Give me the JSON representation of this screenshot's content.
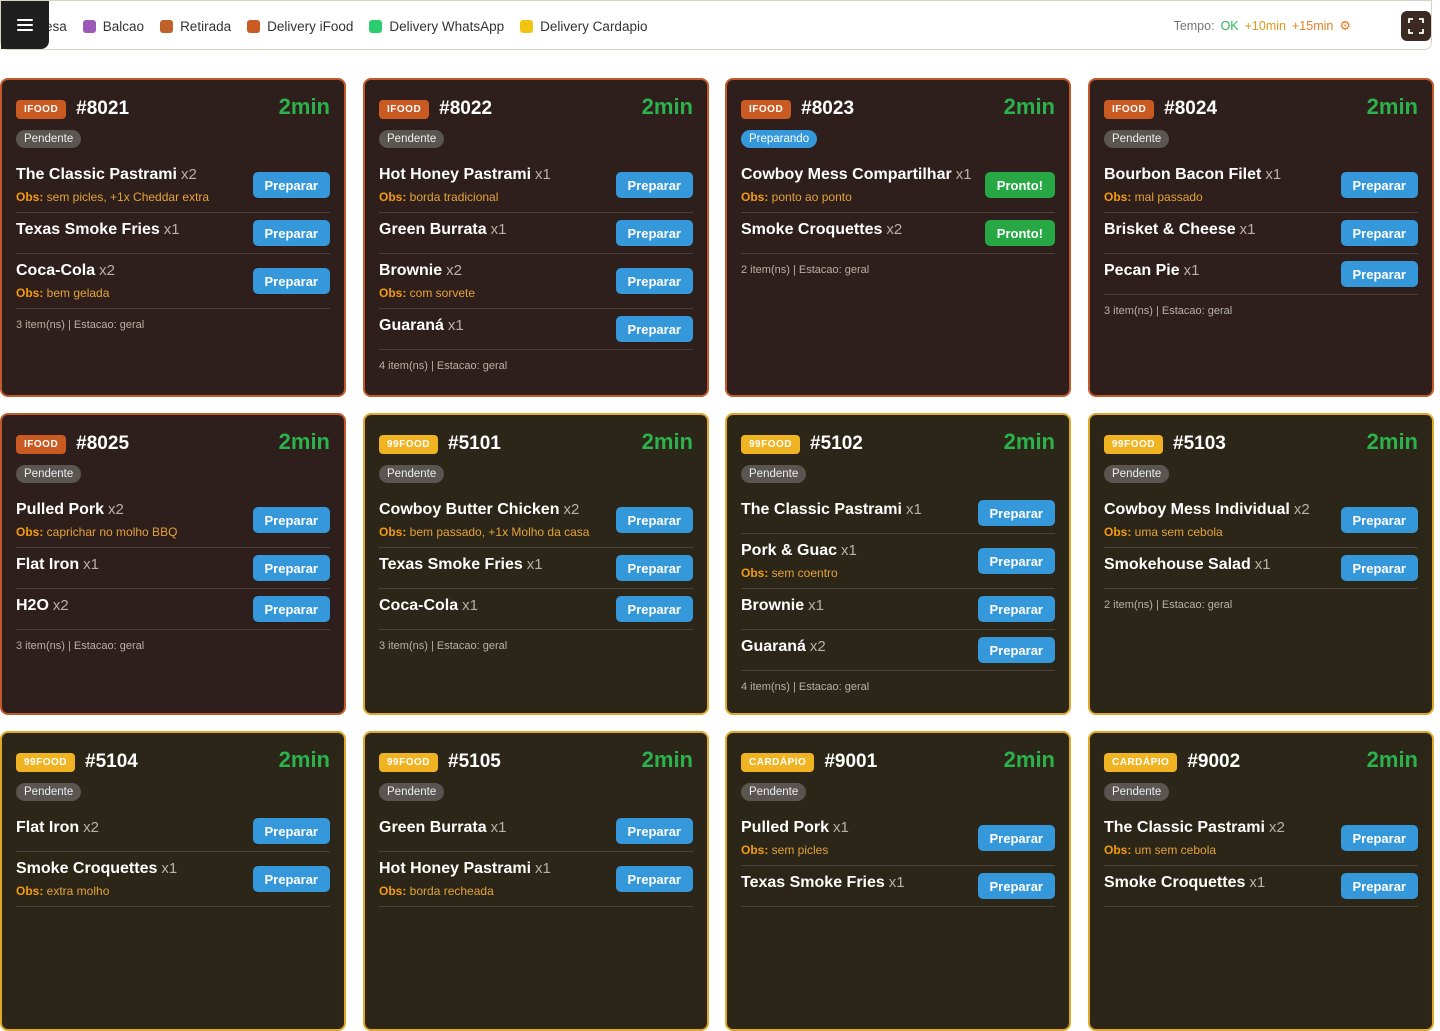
{
  "header": {
    "legend": [
      {
        "label": "esa",
        "color": "#3498db"
      },
      {
        "label": "Balcao",
        "color": "#9b59b6"
      },
      {
        "label": "Retirada",
        "color": "#c0612a"
      },
      {
        "label": "Delivery iFood",
        "color": "#c95a22"
      },
      {
        "label": "Delivery WhatsApp",
        "color": "#2ecc71"
      },
      {
        "label": "Delivery Cardapio",
        "color": "#f1c40f"
      }
    ],
    "tempo_label": "Tempo:",
    "tempo_ok": "OK",
    "tempo_10": "+10min",
    "tempo_15": "+15min",
    "menu_icon": "hamburger-icon",
    "fullscreen_icon": "fullscreen-icon"
  },
  "orders": [
    {
      "kind": "ifood",
      "badge": "IFOOD",
      "number": "#8021",
      "timer": "2min",
      "status": "Pendente",
      "items": [
        {
          "name": "The Classic Pastrami",
          "qty": "x2",
          "obs_label": "Obs:",
          "obs": "sem picles, +1x Cheddar extra",
          "action": "Preparar"
        },
        {
          "name": "Texas Smoke Fries",
          "qty": "x1",
          "action": "Preparar"
        },
        {
          "name": "Coca-Cola",
          "qty": "x2",
          "obs_label": "Obs:",
          "obs": "bem gelada",
          "action": "Preparar"
        }
      ],
      "footer": "3 item(ns) | Estacao: geral"
    },
    {
      "kind": "ifood",
      "badge": "IFOOD",
      "number": "#8022",
      "timer": "2min",
      "status": "Pendente",
      "items": [
        {
          "name": "Hot Honey Pastrami",
          "qty": "x1",
          "obs_label": "Obs:",
          "obs": "borda tradicional",
          "action": "Preparar"
        },
        {
          "name": "Green Burrata",
          "qty": "x1",
          "action": "Preparar"
        },
        {
          "name": "Brownie",
          "qty": "x2",
          "obs_label": "Obs:",
          "obs": "com sorvete",
          "action": "Preparar"
        },
        {
          "name": "Guaraná",
          "qty": "x1",
          "action": "Preparar"
        }
      ],
      "footer": "4 item(ns) | Estacao: geral"
    },
    {
      "kind": "ifood",
      "badge": "IFOOD",
      "number": "#8023",
      "timer": "2min",
      "status": "Preparando",
      "items": [
        {
          "name": "Cowboy Mess Compartilhar",
          "qty": "x1",
          "obs_label": "Obs:",
          "obs": "ponto ao ponto",
          "action": "Pronto!",
          "done": true
        },
        {
          "name": "Smoke Croquettes",
          "qty": "x2",
          "action": "Pronto!",
          "done": true
        }
      ],
      "footer": "2 item(ns) | Estacao: geral"
    },
    {
      "kind": "ifood",
      "badge": "IFOOD",
      "number": "#8024",
      "timer": "2min",
      "status": "Pendente",
      "items": [
        {
          "name": "Bourbon Bacon Filet",
          "qty": "x1",
          "obs_label": "Obs:",
          "obs": "mal passado",
          "action": "Preparar"
        },
        {
          "name": "Brisket & Cheese",
          "qty": "x1",
          "action": "Preparar"
        },
        {
          "name": "Pecan Pie",
          "qty": "x1",
          "action": "Preparar"
        }
      ],
      "footer": "3 item(ns) | Estacao: geral"
    },
    {
      "kind": "ifood",
      "badge": "IFOOD",
      "number": "#8025",
      "timer": "2min",
      "status": "Pendente",
      "items": [
        {
          "name": "Pulled Pork",
          "qty": "x2",
          "obs_label": "Obs:",
          "obs": "caprichar no molho BBQ",
          "action": "Preparar"
        },
        {
          "name": "Flat Iron",
          "qty": "x1",
          "action": "Preparar"
        },
        {
          "name": "H2O",
          "qty": "x2",
          "action": "Preparar"
        }
      ],
      "footer": "3 item(ns) | Estacao: geral"
    },
    {
      "kind": "nn",
      "badge": "99FOOD",
      "number": "#5101",
      "timer": "2min",
      "status": "Pendente",
      "items": [
        {
          "name": "Cowboy Butter Chicken",
          "qty": "x2",
          "obs_label": "Obs:",
          "obs": "bem passado, +1x Molho da casa",
          "action": "Preparar"
        },
        {
          "name": "Texas Smoke Fries",
          "qty": "x1",
          "action": "Preparar"
        },
        {
          "name": "Coca-Cola",
          "qty": "x1",
          "action": "Preparar"
        }
      ],
      "footer": "3 item(ns) | Estacao: geral"
    },
    {
      "kind": "nn",
      "badge": "99FOOD",
      "number": "#5102",
      "timer": "2min",
      "status": "Pendente",
      "items": [
        {
          "name": "The Classic Pastrami",
          "qty": "x1",
          "action": "Preparar"
        },
        {
          "name": "Pork & Guac",
          "qty": "x1",
          "obs_label": "Obs:",
          "obs": "sem coentro",
          "action": "Preparar"
        },
        {
          "name": "Brownie",
          "qty": "x1",
          "action": "Preparar"
        },
        {
          "name": "Guaraná",
          "qty": "x2",
          "action": "Preparar"
        }
      ],
      "footer": "4 item(ns) | Estacao: geral"
    },
    {
      "kind": "nn",
      "badge": "99FOOD",
      "number": "#5103",
      "timer": "2min",
      "status": "Pendente",
      "items": [
        {
          "name": "Cowboy Mess Individual",
          "qty": "x2",
          "obs_label": "Obs:",
          "obs": "uma sem cebola",
          "action": "Preparar"
        },
        {
          "name": "Smokehouse Salad",
          "qty": "x1",
          "action": "Preparar"
        }
      ],
      "footer": "2 item(ns) | Estacao: geral"
    },
    {
      "kind": "nn",
      "badge": "99FOOD",
      "number": "#5104",
      "timer": "2min",
      "status": "Pendente",
      "items": [
        {
          "name": "Flat Iron",
          "qty": "x2",
          "action": "Preparar"
        },
        {
          "name": "Smoke Croquettes",
          "qty": "x1",
          "obs_label": "Obs:",
          "obs": "extra molho",
          "action": "Preparar"
        }
      ],
      "footer": ""
    },
    {
      "kind": "nn",
      "badge": "99FOOD",
      "number": "#5105",
      "timer": "2min",
      "status": "Pendente",
      "items": [
        {
          "name": "Green Burrata",
          "qty": "x1",
          "action": "Preparar"
        },
        {
          "name": "Hot Honey Pastrami",
          "qty": "x1",
          "obs_label": "Obs:",
          "obs": "borda recheada",
          "action": "Preparar"
        }
      ],
      "footer": ""
    },
    {
      "kind": "card-c",
      "badge": "CARDÁPIO",
      "number": "#9001",
      "timer": "2min",
      "status": "Pendente",
      "items": [
        {
          "name": "Pulled Pork",
          "qty": "x1",
          "obs_label": "Obs:",
          "obs": "sem picles",
          "action": "Preparar"
        },
        {
          "name": "Texas Smoke Fries",
          "qty": "x1",
          "action": "Preparar"
        }
      ],
      "footer": ""
    },
    {
      "kind": "card-c",
      "badge": "CARDÁPIO",
      "number": "#9002",
      "timer": "2min",
      "status": "Pendente",
      "items": [
        {
          "name": "The Classic Pastrami",
          "qty": "x2",
          "obs_label": "Obs:",
          "obs": "um sem cebola",
          "action": "Preparar"
        },
        {
          "name": "Smoke Croquettes",
          "qty": "x1",
          "action": "Preparar"
        }
      ],
      "footer": ""
    }
  ]
}
